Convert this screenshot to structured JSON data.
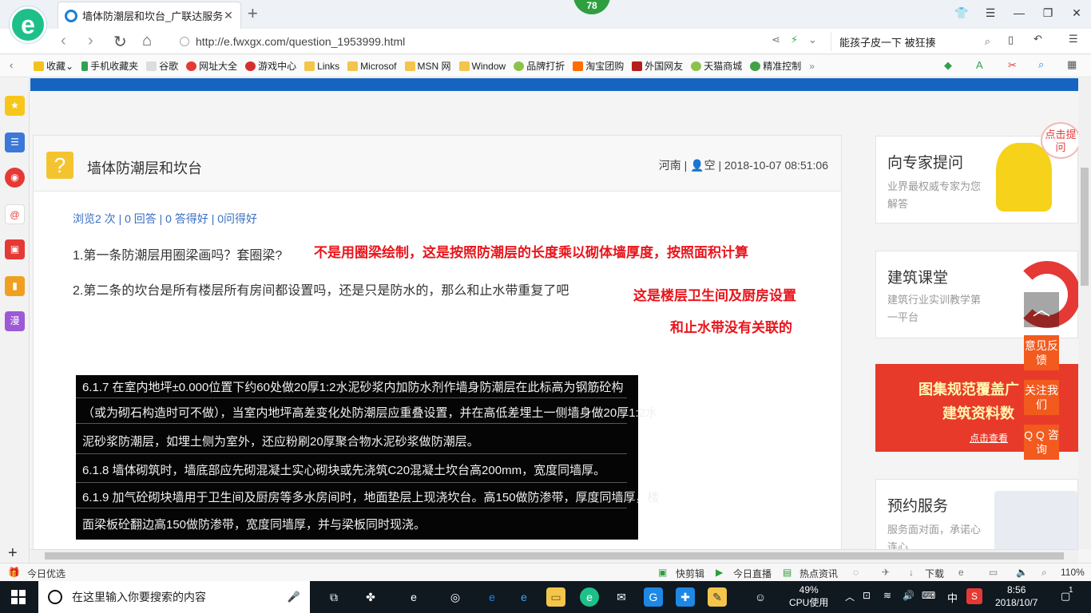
{
  "browser": {
    "tab_title": "墙体防潮层和坎台_广联达服务新",
    "badge": "78",
    "url": "http://e.fwxgx.com/question_1953999.html",
    "search_text": "能孩子皮一下 被狂揍"
  },
  "bookmarks": [
    {
      "label": "收藏"
    },
    {
      "label": "手机收藏夹"
    },
    {
      "label": "谷歌"
    },
    {
      "label": "网址大全"
    },
    {
      "label": "游戏中心"
    },
    {
      "label": "Links"
    },
    {
      "label": "Microsof"
    },
    {
      "label": "MSN 网"
    },
    {
      "label": "Window"
    },
    {
      "label": "品牌打折"
    },
    {
      "label": "淘宝团购"
    },
    {
      "label": "外国网友"
    },
    {
      "label": "天猫商城"
    },
    {
      "label": "精准控制"
    }
  ],
  "sidebar": {
    "manga_label": "漫"
  },
  "question": {
    "title": "墙体防潮层和坎台",
    "location": "河南",
    "user": "空",
    "datetime": "2018-10-07 08:51:06",
    "stats": "浏览2 次 | 0 回答 | 0 答得好 | 0问得好",
    "line1": "1.第一条防潮层用圈梁画吗？套圈梁?",
    "line2": "2.第二条的坎台是所有楼层所有房间都设置吗，还是只是防水的，那么和止水带重复了吧",
    "answer1": "不是用圈梁绘制，这是按照防潮层的长度乘以砌体墙厚度，按照面积计算",
    "answer2a": "这是楼层卫生间及厨房设置",
    "answer2b": "和止水带没有关联的"
  },
  "spec_text": {
    "r1": "6.1.7  在室内地坪±0.000位置下约60处做20厚1:2水泥砂浆内加防水剂作墙身防潮层在此标高为钢筋砼构",
    "r2": "（或为砌石构造时可不做），当室内地坪高差变化处防潮层应重叠设置，并在高低差埋土一侧墙身做20厚1:2水",
    "r3": "泥砂浆防潮层，如埋土侧为室外，还应粉刷20厚聚合物水泥砂浆做防潮层。",
    "r4": "6.1.8  墙体砌筑时，墙底部应先砌混凝土实心砌块或先浇筑C20混凝土坎台高200mm，宽度同墙厚。",
    "r5": "6.1.9  加气砼砌块墙用于卫生间及厨房等多水房间时，地面垫层上现浇坎台。高150做防渗带，厚度同墙厚，楼",
    "r6": "面梁板砼翻边高150做防渗带，宽度同墙厚，并与梁板同时现浇。"
  },
  "right": {
    "expert_title": "向专家提问",
    "expert_sub": "业界最权威专家为您解答",
    "expert_bubble": "点击提问",
    "class_title": "建筑课堂",
    "class_sub": "建筑行业实训教学第一平台",
    "banner_l1": "图集规范覆盖广",
    "banner_l2": "建筑资料数",
    "banner_l3": "点击查看",
    "service_title": "预约服务",
    "service_sub": "服务面对面，承诺心连心"
  },
  "float": {
    "feedback": "意见反馈",
    "follow": "关注我们",
    "qq": "Q Q 咨询"
  },
  "statusbar": {
    "today": "今日优选",
    "kuaijian": "快剪辑",
    "live": "今日直播",
    "hot": "热点资讯",
    "download": "下载",
    "zoom": "110%"
  },
  "taskbar": {
    "search_placeholder": "在这里输入你要搜索的内容",
    "cpu_pct": "49%",
    "cpu_label": "CPU使用",
    "ime": "中",
    "time": "8:56",
    "date": "2018/10/7",
    "notify_count": "1"
  },
  "colors": {
    "accent_blue": "#1565c0",
    "annotation_red": "#e8151b",
    "float_orange": "#f35a1d"
  }
}
